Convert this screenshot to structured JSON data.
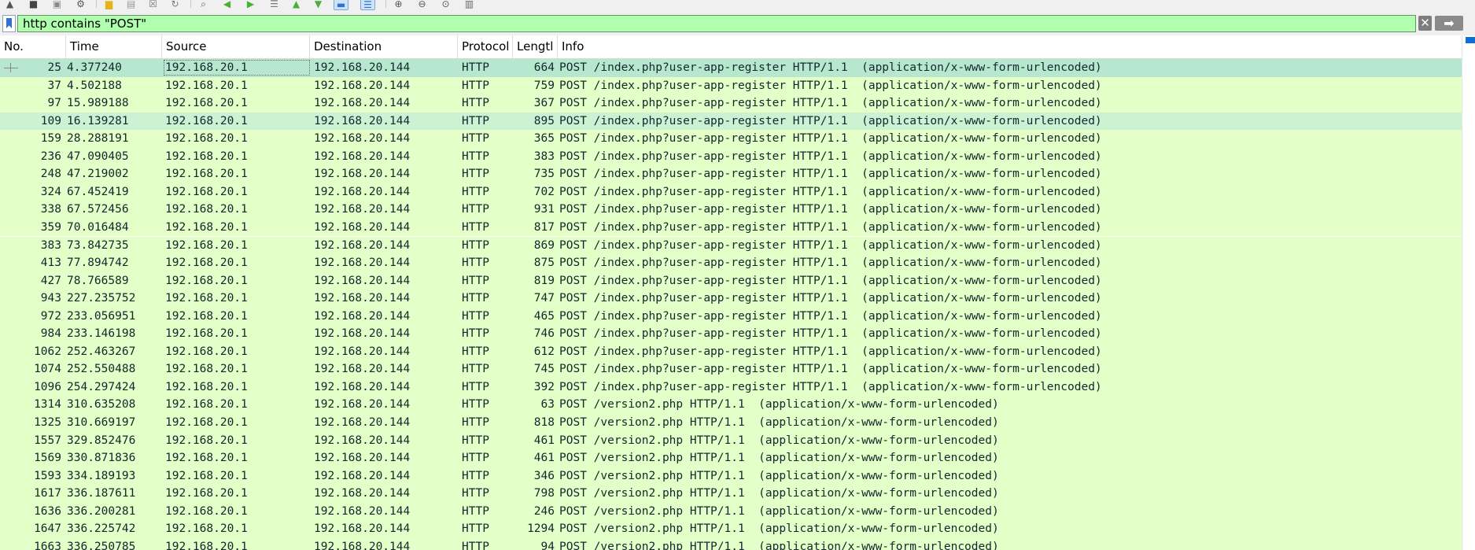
{
  "toolbar": {
    "icons": [
      "start-capture-icon",
      "stop-capture-icon",
      "restart-capture-icon",
      "capture-options-icon",
      "open-file-icon",
      "save-file-icon",
      "close-file-icon",
      "reload-file-icon",
      "find-packet-icon",
      "go-back-icon",
      "go-forward-icon",
      "go-to-packet-icon",
      "go-first-icon",
      "go-last-icon",
      "auto-scroll-icon",
      "colorize-icon",
      "zoom-in-icon",
      "zoom-out-icon",
      "zoom-normal-icon",
      "resize-columns-icon"
    ]
  },
  "filter": {
    "value": "http contains \"POST\"",
    "clear_glyph": "✕",
    "apply_glyph": "➡"
  },
  "columns": [
    "No.",
    "Time",
    "Source",
    "Destination",
    "Protocol",
    "Lengtl",
    "Info"
  ],
  "packets": [
    {
      "no": "25",
      "time": "4.377240",
      "src": "192.168.20.1",
      "dst": "192.168.20.144",
      "proto": "HTTP",
      "len": "664",
      "info": "POST /index.php?user-app-register HTTP/1.1  (application/x-www-form-urlencoded)"
    },
    {
      "no": "37",
      "time": "4.502188",
      "src": "192.168.20.1",
      "dst": "192.168.20.144",
      "proto": "HTTP",
      "len": "759",
      "info": "POST /index.php?user-app-register HTTP/1.1  (application/x-www-form-urlencoded)"
    },
    {
      "no": "97",
      "time": "15.989188",
      "src": "192.168.20.1",
      "dst": "192.168.20.144",
      "proto": "HTTP",
      "len": "367",
      "info": "POST /index.php?user-app-register HTTP/1.1  (application/x-www-form-urlencoded)"
    },
    {
      "no": "109",
      "time": "16.139281",
      "src": "192.168.20.1",
      "dst": "192.168.20.144",
      "proto": "HTTP",
      "len": "895",
      "info": "POST /index.php?user-app-register HTTP/1.1  (application/x-www-form-urlencoded)"
    },
    {
      "no": "159",
      "time": "28.288191",
      "src": "192.168.20.1",
      "dst": "192.168.20.144",
      "proto": "HTTP",
      "len": "365",
      "info": "POST /index.php?user-app-register HTTP/1.1  (application/x-www-form-urlencoded)"
    },
    {
      "no": "236",
      "time": "47.090405",
      "src": "192.168.20.1",
      "dst": "192.168.20.144",
      "proto": "HTTP",
      "len": "383",
      "info": "POST /index.php?user-app-register HTTP/1.1  (application/x-www-form-urlencoded)"
    },
    {
      "no": "248",
      "time": "47.219002",
      "src": "192.168.20.1",
      "dst": "192.168.20.144",
      "proto": "HTTP",
      "len": "735",
      "info": "POST /index.php?user-app-register HTTP/1.1  (application/x-www-form-urlencoded)"
    },
    {
      "no": "324",
      "time": "67.452419",
      "src": "192.168.20.1",
      "dst": "192.168.20.144",
      "proto": "HTTP",
      "len": "702",
      "info": "POST /index.php?user-app-register HTTP/1.1  (application/x-www-form-urlencoded)"
    },
    {
      "no": "338",
      "time": "67.572456",
      "src": "192.168.20.1",
      "dst": "192.168.20.144",
      "proto": "HTTP",
      "len": "931",
      "info": "POST /index.php?user-app-register HTTP/1.1  (application/x-www-form-urlencoded)"
    },
    {
      "no": "359",
      "time": "70.016484",
      "src": "192.168.20.1",
      "dst": "192.168.20.144",
      "proto": "HTTP",
      "len": "817",
      "info": "POST /index.php?user-app-register HTTP/1.1  (application/x-www-form-urlencoded)"
    },
    {
      "no": "383",
      "time": "73.842735",
      "src": "192.168.20.1",
      "dst": "192.168.20.144",
      "proto": "HTTP",
      "len": "869",
      "info": "POST /index.php?user-app-register HTTP/1.1  (application/x-www-form-urlencoded)"
    },
    {
      "no": "413",
      "time": "77.894742",
      "src": "192.168.20.1",
      "dst": "192.168.20.144",
      "proto": "HTTP",
      "len": "875",
      "info": "POST /index.php?user-app-register HTTP/1.1  (application/x-www-form-urlencoded)"
    },
    {
      "no": "427",
      "time": "78.766589",
      "src": "192.168.20.1",
      "dst": "192.168.20.144",
      "proto": "HTTP",
      "len": "819",
      "info": "POST /index.php?user-app-register HTTP/1.1  (application/x-www-form-urlencoded)"
    },
    {
      "no": "943",
      "time": "227.235752",
      "src": "192.168.20.1",
      "dst": "192.168.20.144",
      "proto": "HTTP",
      "len": "747",
      "info": "POST /index.php?user-app-register HTTP/1.1  (application/x-www-form-urlencoded)"
    },
    {
      "no": "972",
      "time": "233.056951",
      "src": "192.168.20.1",
      "dst": "192.168.20.144",
      "proto": "HTTP",
      "len": "465",
      "info": "POST /index.php?user-app-register HTTP/1.1  (application/x-www-form-urlencoded)"
    },
    {
      "no": "984",
      "time": "233.146198",
      "src": "192.168.20.1",
      "dst": "192.168.20.144",
      "proto": "HTTP",
      "len": "746",
      "info": "POST /index.php?user-app-register HTTP/1.1  (application/x-www-form-urlencoded)"
    },
    {
      "no": "1062",
      "time": "252.463267",
      "src": "192.168.20.1",
      "dst": "192.168.20.144",
      "proto": "HTTP",
      "len": "612",
      "info": "POST /index.php?user-app-register HTTP/1.1  (application/x-www-form-urlencoded)"
    },
    {
      "no": "1074",
      "time": "252.550488",
      "src": "192.168.20.1",
      "dst": "192.168.20.144",
      "proto": "HTTP",
      "len": "745",
      "info": "POST /index.php?user-app-register HTTP/1.1  (application/x-www-form-urlencoded)"
    },
    {
      "no": "1096",
      "time": "254.297424",
      "src": "192.168.20.1",
      "dst": "192.168.20.144",
      "proto": "HTTP",
      "len": "392",
      "info": "POST /index.php?user-app-register HTTP/1.1  (application/x-www-form-urlencoded)"
    },
    {
      "no": "1314",
      "time": "310.635208",
      "src": "192.168.20.1",
      "dst": "192.168.20.144",
      "proto": "HTTP",
      "len": "63",
      "info": "POST /version2.php HTTP/1.1  (application/x-www-form-urlencoded)"
    },
    {
      "no": "1325",
      "time": "310.669197",
      "src": "192.168.20.1",
      "dst": "192.168.20.144",
      "proto": "HTTP",
      "len": "818",
      "info": "POST /version2.php HTTP/1.1  (application/x-www-form-urlencoded)"
    },
    {
      "no": "1557",
      "time": "329.852476",
      "src": "192.168.20.1",
      "dst": "192.168.20.144",
      "proto": "HTTP",
      "len": "461",
      "info": "POST /version2.php HTTP/1.1  (application/x-www-form-urlencoded)"
    },
    {
      "no": "1569",
      "time": "330.871836",
      "src": "192.168.20.1",
      "dst": "192.168.20.144",
      "proto": "HTTP",
      "len": "461",
      "info": "POST /version2.php HTTP/1.1  (application/x-www-form-urlencoded)"
    },
    {
      "no": "1593",
      "time": "334.189193",
      "src": "192.168.20.1",
      "dst": "192.168.20.144",
      "proto": "HTTP",
      "len": "346",
      "info": "POST /version2.php HTTP/1.1  (application/x-www-form-urlencoded)"
    },
    {
      "no": "1617",
      "time": "336.187611",
      "src": "192.168.20.1",
      "dst": "192.168.20.144",
      "proto": "HTTP",
      "len": "798",
      "info": "POST /version2.php HTTP/1.1  (application/x-www-form-urlencoded)"
    },
    {
      "no": "1636",
      "time": "336.200281",
      "src": "192.168.20.1",
      "dst": "192.168.20.144",
      "proto": "HTTP",
      "len": "246",
      "info": "POST /version2.php HTTP/1.1  (application/x-www-form-urlencoded)"
    },
    {
      "no": "1647",
      "time": "336.225742",
      "src": "192.168.20.1",
      "dst": "192.168.20.144",
      "proto": "HTTP",
      "len": "1294",
      "info": "POST /version2.php HTTP/1.1  (application/x-www-form-urlencoded)"
    },
    {
      "no": "1663",
      "time": "336.250785",
      "src": "192.168.20.1",
      "dst": "192.168.20.144",
      "proto": "HTTP",
      "len": "94",
      "info": "POST /version2.php HTTP/1.1  (application/x-www-form-urlencoded)"
    }
  ],
  "selected_row": 0,
  "highlighted_row": 3,
  "colors": {
    "http_row": "#e4ffc7",
    "selected_row": "#b7e8cf",
    "highlighted_row": "#cbf2d3",
    "filter_valid": "#afffaf",
    "row_text": "#12272e"
  }
}
